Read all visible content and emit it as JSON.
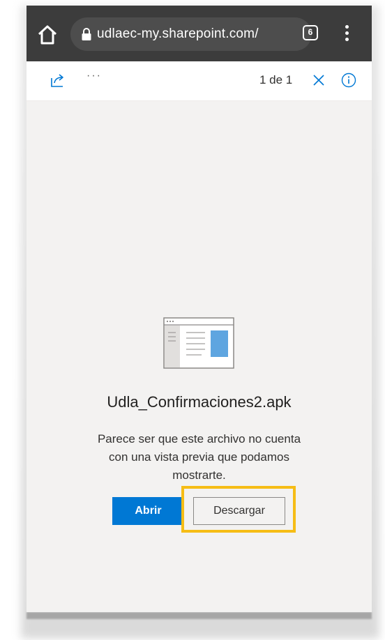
{
  "browser": {
    "url": "udlaec-my.sharepoint.com/",
    "tab_count": "6",
    "icons": {
      "home": "home-icon",
      "lock": "lock-icon",
      "menu": "kebab-menu-icon"
    }
  },
  "viewer_toolbar": {
    "more": "···",
    "page_count": "1 de 1",
    "icons": {
      "share": "share-icon",
      "close": "close-icon",
      "info": "info-icon"
    }
  },
  "preview": {
    "file_name": "Udla_Confirmaciones2.apk",
    "message": "Parece ser que este archivo no cuenta con una vista previa que podamos mostrarte.",
    "open_label": "Abrir",
    "download_label": "Descargar"
  },
  "colors": {
    "chrome_bar": "#3c3c3c",
    "primary_button": "#0078d4",
    "highlight": "#f6bd16"
  }
}
